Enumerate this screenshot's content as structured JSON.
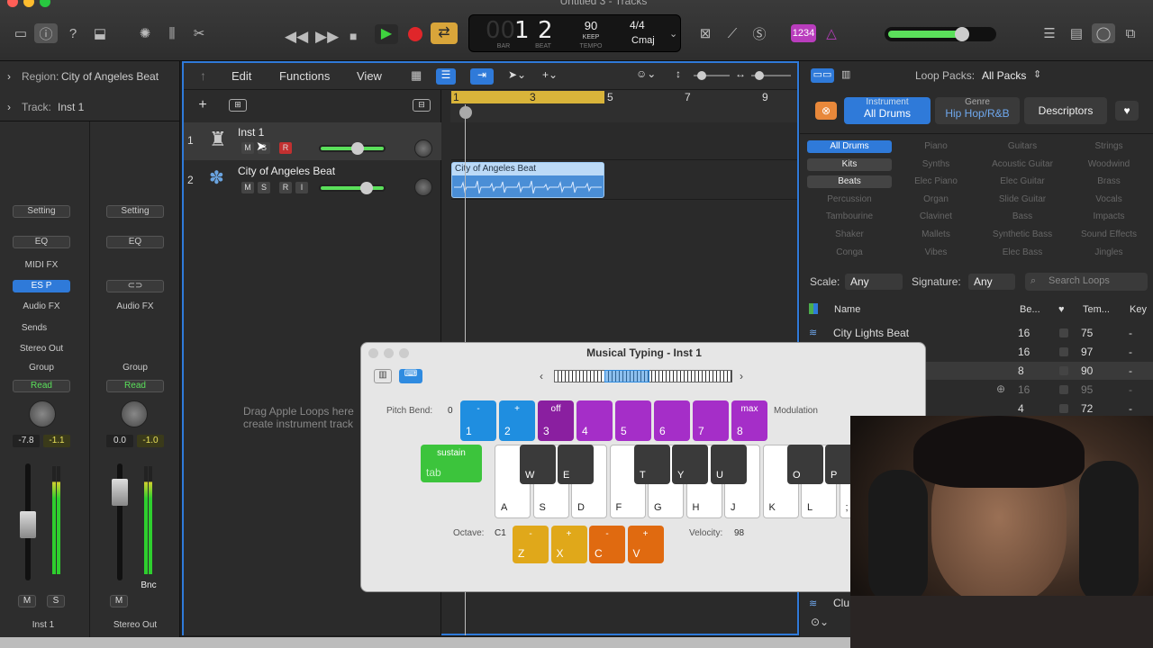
{
  "window": {
    "title": "Untitled 3 - Tracks"
  },
  "lcd": {
    "bar": "1",
    "beat": "2",
    "bar_prefix": "00",
    "bar_label": "BAR",
    "beat_label": "BEAT",
    "tempo": "90",
    "tempo_mode": "KEEP",
    "tempo_label": "TEMPO",
    "signature": "4/4",
    "key": "Cmaj"
  },
  "toolbar": {
    "counter_badge": "1234"
  },
  "inspector": {
    "region_label": "Region:",
    "region_name": "City of Angeles Beat",
    "track_label": "Track:",
    "track_name": "Inst 1",
    "strip1": {
      "setting": "Setting",
      "eq": "EQ",
      "midifx": "MIDI FX",
      "instrument": "ES P",
      "audiofx": "Audio FX",
      "sends": "Sends",
      "output": "Stereo Out",
      "group": "Group",
      "automation": "Read",
      "vol": "-7.8",
      "peak": "-1.1",
      "mute": "M",
      "solo": "S",
      "name": "Inst 1"
    },
    "strip2": {
      "setting": "Setting",
      "eq": "EQ",
      "audiofx": "Audio FX",
      "group": "Group",
      "automation": "Read",
      "vol": "0.0",
      "peak": "-1.0",
      "mute": "M",
      "bounce": "Bnc",
      "name": "Stereo Out"
    }
  },
  "menus": {
    "edit": "Edit",
    "functions": "Functions",
    "view": "View"
  },
  "tracks": [
    {
      "num": "1",
      "name": "Inst 1",
      "m": "M",
      "s": "S",
      "r": "R"
    },
    {
      "num": "2",
      "name": "City of Angeles Beat",
      "m": "M",
      "s": "S",
      "r": "R",
      "i": "I"
    }
  ],
  "ruler": [
    "1",
    "3",
    "5",
    "7",
    "9"
  ],
  "region": {
    "name": "City of Angeles Beat"
  },
  "drag_hint": "Drag Apple Loops here create instrument track",
  "browser": {
    "loop_packs_label": "Loop Packs:",
    "loop_packs_value": "All Packs",
    "instrument_label": "Instrument",
    "instrument_value": "All Drums",
    "genre_label": "Genre",
    "genre_value": "Hip Hop/R&B",
    "descriptors": "Descriptors",
    "categories": [
      [
        "All Drums",
        "Piano",
        "Guitars",
        "Strings"
      ],
      [
        "Kits",
        "Synths",
        "Acoustic Guitar",
        "Woodwind"
      ],
      [
        "Beats",
        "Elec Piano",
        "Elec Guitar",
        "Brass"
      ],
      [
        "Percussion",
        "Organ",
        "Slide Guitar",
        "Vocals"
      ],
      [
        "Tambourine",
        "Clavinet",
        "Bass",
        "Impacts"
      ],
      [
        "Shaker",
        "Mallets",
        "Synthetic Bass",
        "Sound Effects"
      ],
      [
        "Conga",
        "Vibes",
        "Elec Bass",
        "Jingles"
      ]
    ],
    "scale_label": "Scale:",
    "scale_value": "Any",
    "signature_label": "Signature:",
    "signature_value": "Any",
    "search_placeholder": "Search Loops",
    "columns": {
      "name": "Name",
      "beats": "Be...",
      "tempo": "Tem...",
      "key": "Key"
    },
    "rows": [
      {
        "name": "City Lights Beat",
        "beats": "16",
        "tempo": "75",
        "key": "-"
      },
      {
        "name": "",
        "beats": "16",
        "tempo": "97",
        "key": "-"
      },
      {
        "name": "t",
        "beats": "8",
        "tempo": "90",
        "key": "-"
      },
      {
        "name": "",
        "beats": "16",
        "tempo": "95",
        "key": "-"
      },
      {
        "name": "eat",
        "beats": "4",
        "tempo": "72",
        "key": "-"
      }
    ],
    "bottom_row": "Clu"
  },
  "musical_typing": {
    "title": "Musical Typing - Inst 1",
    "pitch_bend_label": "Pitch Bend:",
    "pitch_bend_value": "0",
    "modulation_label": "Modulation",
    "top_keys": [
      {
        "top": "-",
        "label": "1",
        "color": "#1f8ee0"
      },
      {
        "top": "+",
        "label": "2",
        "color": "#1f8ee0"
      },
      {
        "top": "off",
        "label": "3",
        "color": "#8a1fa0"
      },
      {
        "top": "",
        "label": "4",
        "color": "#a52ec8"
      },
      {
        "top": "",
        "label": "5",
        "color": "#a52ec8"
      },
      {
        "top": "",
        "label": "6",
        "color": "#a52ec8"
      },
      {
        "top": "",
        "label": "7",
        "color": "#a52ec8"
      },
      {
        "top": "max",
        "label": "8",
        "color": "#a52ec8"
      }
    ],
    "sustain_top": "sustain",
    "sustain_label": "tab",
    "white_keys": [
      "A",
      "S",
      "D",
      "F",
      "G",
      "H",
      "J",
      "K",
      "L",
      ";"
    ],
    "black_keys": [
      "W",
      "E",
      "T",
      "Y",
      "U",
      "O",
      "P"
    ],
    "octave_label": "Octave:",
    "octave_value": "C1",
    "octave_keys": [
      {
        "top": "-",
        "label": "Z",
        "color": "#e0a81a"
      },
      {
        "top": "+",
        "label": "X",
        "color": "#e0a81a"
      }
    ],
    "velocity_keys": [
      {
        "top": "-",
        "label": "C",
        "color": "#e06a10"
      },
      {
        "top": "+",
        "label": "V",
        "color": "#e06a10"
      }
    ],
    "velocity_label": "Velocity:",
    "velocity_value": "98"
  }
}
